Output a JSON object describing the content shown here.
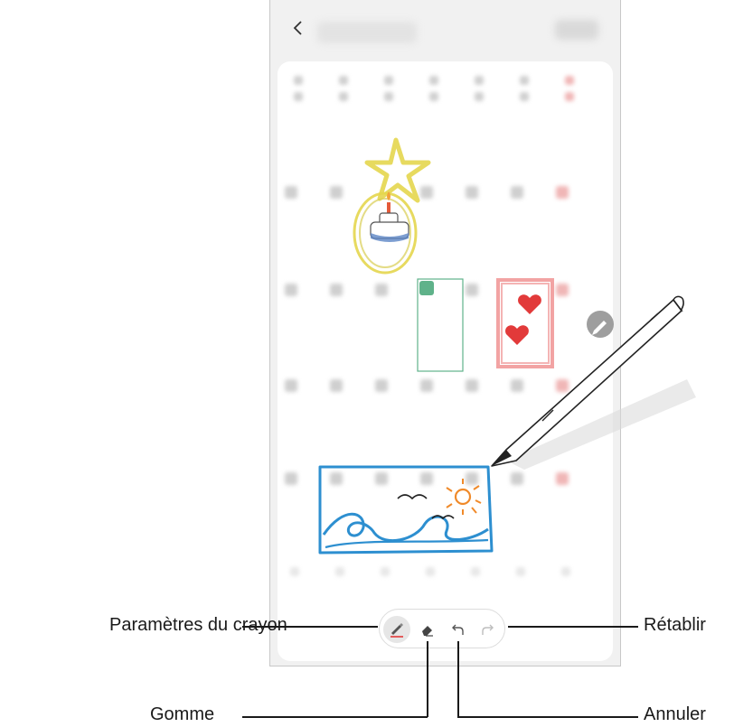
{
  "callouts": {
    "pen_settings": "Paramètres du crayon",
    "eraser": "Gomme",
    "redo": "Rétablir",
    "undo": "Annuler"
  },
  "toolbar": {
    "tools": [
      "pen-settings",
      "eraser",
      "undo",
      "redo"
    ],
    "active_tool": "pen-settings"
  },
  "icons": {
    "back": "chevron-left-icon",
    "edit": "pencil-icon",
    "pen": "brush-icon",
    "eraser": "eraser-icon",
    "undo": "undo-arrow-icon",
    "redo": "redo-arrow-icon"
  },
  "colors": {
    "drawing_yellow": "#e4d64e",
    "drawing_blue": "#2d8fd0",
    "drawing_pink": "#f2a3a3",
    "drawing_red": "#e23a3a",
    "event_green": "#5fb28a",
    "edit_button": "#9e9e9e"
  }
}
